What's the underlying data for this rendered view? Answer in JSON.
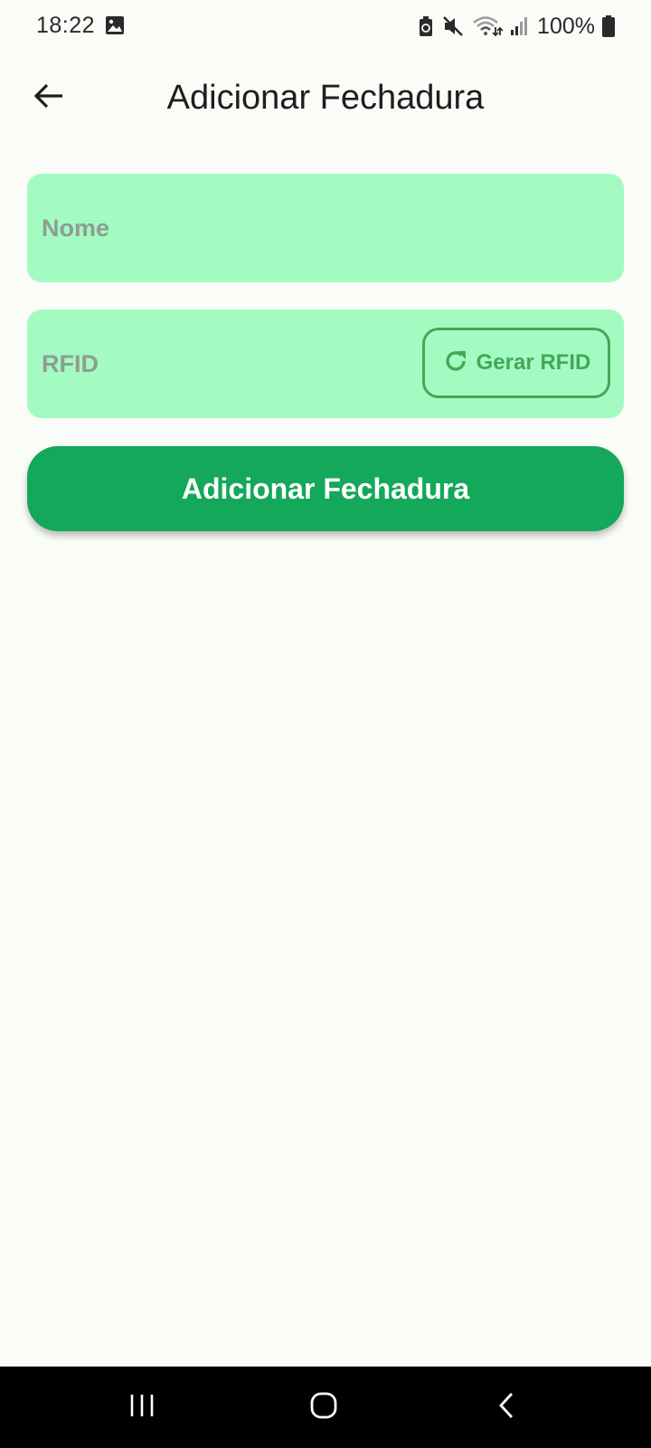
{
  "status_bar": {
    "time": "18:22",
    "battery": "100%",
    "icons": [
      "gallery-icon",
      "data-saver-icon",
      "mute-icon",
      "wifi-icon",
      "signal-icon",
      "battery-icon"
    ]
  },
  "app_bar": {
    "title": "Adicionar Fechadura",
    "back_icon": "arrow-back-icon"
  },
  "form": {
    "nome": {
      "placeholder": "Nome",
      "value": ""
    },
    "rfid": {
      "placeholder": "RFID",
      "value": ""
    },
    "gerar_button": {
      "label": "Gerar RFID",
      "icon": "refresh-icon"
    },
    "submit_label": "Adicionar Fechadura"
  },
  "nav_bar": {
    "buttons": [
      "recents-icon",
      "home-icon",
      "back-nav-icon"
    ]
  },
  "colors": {
    "background": "#FAFCF8",
    "field_fill": "#A3FBC2",
    "accent_green": "#43A857",
    "primary_button": "#13A85A",
    "placeholder_text": "#8E9D93",
    "nav_bar": "#000000"
  }
}
